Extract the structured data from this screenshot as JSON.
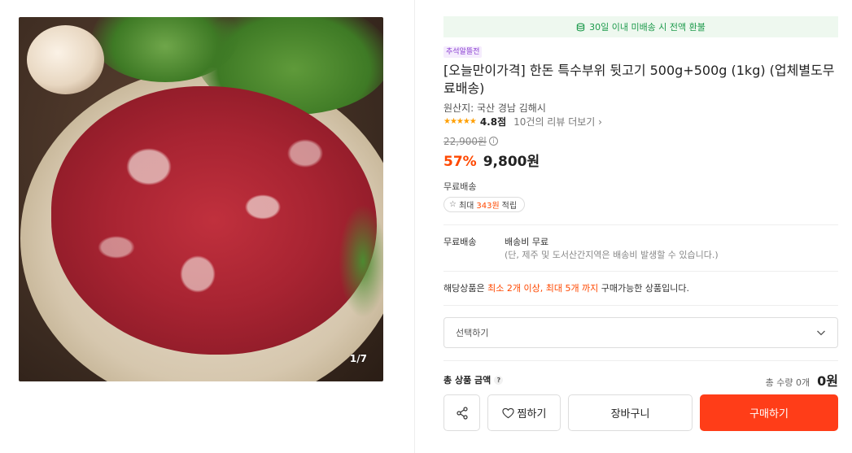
{
  "gallery": {
    "counter": "1/7"
  },
  "banner": {
    "refund_text": "30일 이내 미배송 시 전액 환불",
    "icon": "coins-icon"
  },
  "product": {
    "event_badge": "추석알뜰전",
    "title": "[오늘만이가격] 한돈 특수부위 뒷고기 500g+500g (1kg) (업체별도무료배송)",
    "origin": "원산지: 국산 경남 김해시",
    "stars": "★★★★★",
    "rating": "4.8점",
    "review_link": "10건의 리뷰 더보기",
    "original_price": "22,900원",
    "discount": "57%",
    "price": "9,800원"
  },
  "shipping": {
    "label": "무료배송",
    "points_prefix": "최대",
    "points_amount": "343원",
    "points_suffix": "적립"
  },
  "delivery": {
    "label": "무료배송",
    "fee": "배송비 무료",
    "note": "(단, 제주 및 도서산간지역은 배송비 발생할 수 있습니다.)"
  },
  "limit": {
    "prefix": "해당상품은",
    "min": "최소 2개 이상,",
    "max": "최대 5개 까지",
    "suffix": "구매가능한 상품입니다."
  },
  "option": {
    "placeholder": "선택하기"
  },
  "total": {
    "label": "총 상품 금액",
    "help": "?",
    "qty": "총 수량 0개",
    "price": "0원"
  },
  "actions": {
    "wish_label": "찜하기",
    "cart_label": "장바구니",
    "buy_label": "구매하기"
  },
  "colors": {
    "accent": "#ff3d18",
    "discount": "#ff4800",
    "banner_bg": "#eef8ef",
    "banner_text": "#1d9a4c",
    "badge_text": "#8a3fd1"
  }
}
